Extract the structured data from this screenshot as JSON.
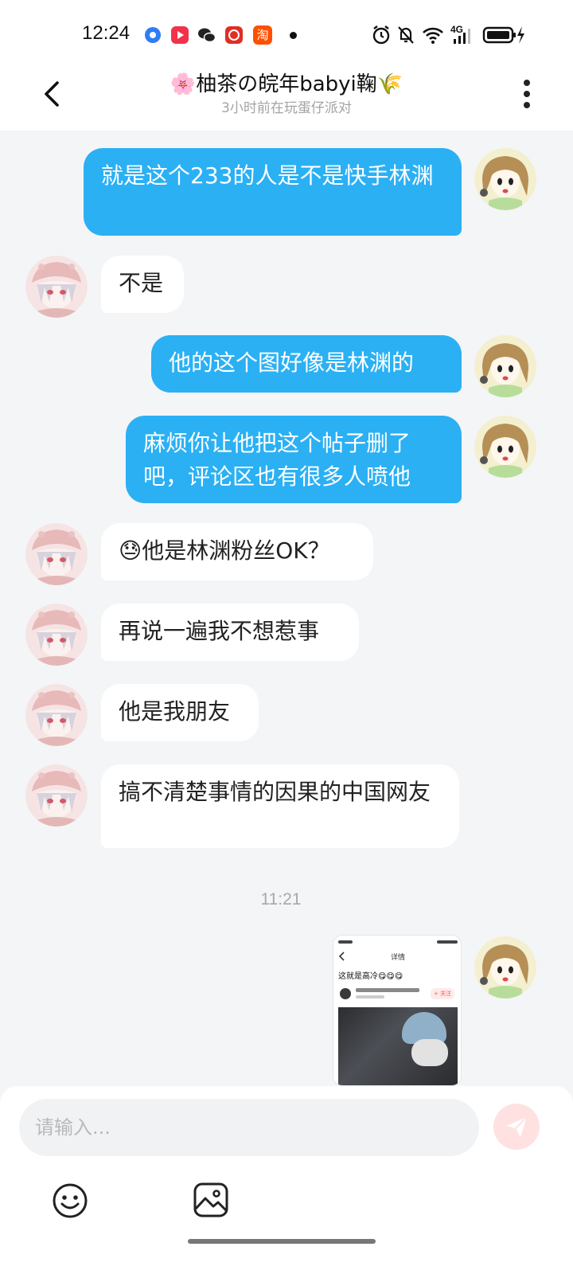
{
  "status_bar": {
    "time": "12:24",
    "taobao_icon_text": "淘",
    "network": "4G"
  },
  "header": {
    "title": "🌸柚茶の皖年babyi鞠🌾",
    "subtitle": "3小时前在玩蛋仔派对"
  },
  "messages": [
    {
      "side": "out",
      "text": "就是这个233的人是不是快手林渊"
    },
    {
      "side": "in",
      "text": "不是"
    },
    {
      "side": "out",
      "text": "他的这个图好像是林渊的"
    },
    {
      "side": "out",
      "text": "麻烦你让他把这个帖子删了吧，评论区也有很多人喷他"
    },
    {
      "side": "in",
      "text": "😓他是林渊粉丝OK？"
    },
    {
      "side": "in",
      "text": "再说一遍我不想惹事"
    },
    {
      "side": "in",
      "text": "他是我朋友"
    },
    {
      "side": "in",
      "text": "搞不清楚事情的因果的中国网友"
    }
  ],
  "timestamp": "11:21",
  "image_message": {
    "post_title": "这就是高冷😋😋😋",
    "header_text": "详情",
    "follow_label": "+ 关注"
  },
  "input": {
    "placeholder": "请输入..."
  },
  "colors": {
    "outgoing_bubble": "#2bb0f4",
    "incoming_bubble": "#ffffff",
    "background": "#f4f5f7",
    "send_button": "#ffe1e1"
  }
}
